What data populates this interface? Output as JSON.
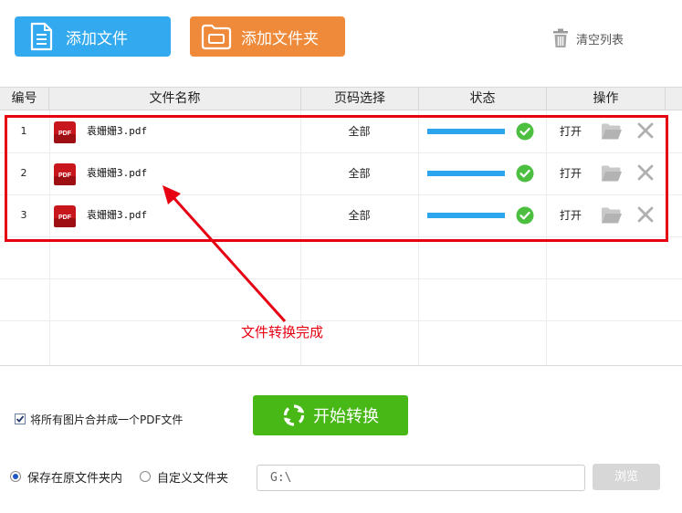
{
  "toolbar": {
    "add_file_label": "添加文件",
    "add_folder_label": "添加文件夹",
    "clear_list_label": "清空列表"
  },
  "table": {
    "columns": [
      "编号",
      "文件名称",
      "页码选择",
      "状态",
      "操作"
    ],
    "rows": [
      {
        "index": "1",
        "file_name": "袁姗姗3.pdf",
        "pages": "全部",
        "progress": 1.0,
        "status": "done",
        "open_label": "打开"
      },
      {
        "index": "2",
        "file_name": "袁姗姗3.pdf",
        "pages": "全部",
        "progress": 1.0,
        "status": "done",
        "open_label": "打开"
      },
      {
        "index": "3",
        "file_name": "袁姗姗3.pdf",
        "pages": "全部",
        "progress": 1.0,
        "status": "done",
        "open_label": "打开"
      }
    ]
  },
  "annotation": {
    "text": "文件转换完成",
    "color": "#e60012"
  },
  "options": {
    "merge_label": "将所有图片合并成一个PDF文件",
    "merge_checked": true,
    "start_label": "开始转换",
    "save_original_label": "保存在原文件夹内",
    "save_custom_label": "自定义文件夹",
    "save_mode": "original",
    "path_value": "G:\\",
    "browse_label": "浏览"
  },
  "colors": {
    "add_file": "#33aaf0",
    "add_folder": "#ee8a3a",
    "start": "#47b816",
    "progress": "#2ba6ee",
    "ok": "#4cbf40"
  },
  "icons": {
    "add_file": "document-icon",
    "add_folder": "folder-icon",
    "clear": "trash-icon",
    "file_type": "pdf-icon",
    "status": "check-circle-icon",
    "open_folder": "folder-open-icon",
    "delete": "close-icon",
    "start": "refresh-icon"
  }
}
